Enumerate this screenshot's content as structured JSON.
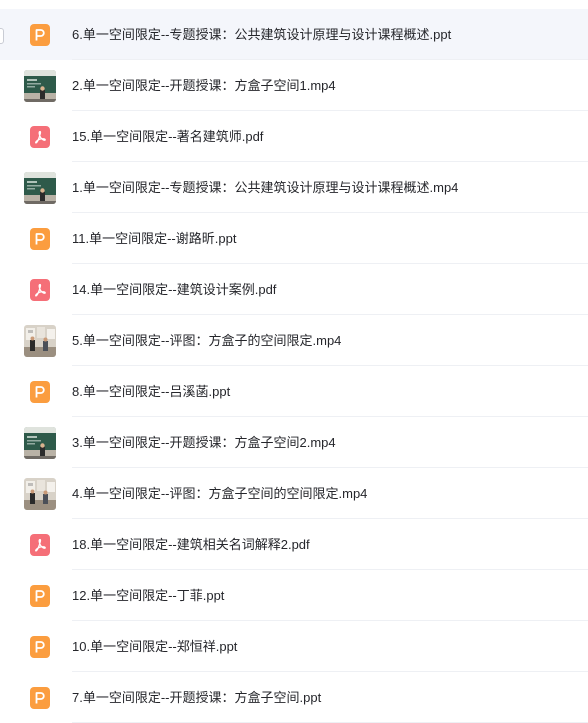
{
  "files": [
    {
      "name": "6.单一空间限定--专题授课：公共建筑设计原理与设计课程概述.ppt",
      "type": "ppt",
      "icon": "ppt-file-icon",
      "selected": true
    },
    {
      "name": "2.单一空间限定--开题授课：方盒子空间1.mp4",
      "type": "mp4",
      "thumb": "classroom",
      "icon": "video-thumbnail"
    },
    {
      "name": "15.单一空间限定--著名建筑师.pdf",
      "type": "pdf",
      "icon": "pdf-file-icon"
    },
    {
      "name": "1.单一空间限定--专题授课：公共建筑设计原理与设计课程概述.mp4",
      "type": "mp4",
      "thumb": "classroom",
      "icon": "video-thumbnail"
    },
    {
      "name": "11.单一空间限定--谢路昕.ppt",
      "type": "ppt",
      "icon": "ppt-file-icon"
    },
    {
      "name": "14.单一空间限定--建筑设计案例.pdf",
      "type": "pdf",
      "icon": "pdf-file-icon"
    },
    {
      "name": "5.单一空间限定--评图：方盒子的空间限定.mp4",
      "type": "mp4",
      "thumb": "review",
      "icon": "video-thumbnail"
    },
    {
      "name": "8.单一空间限定--吕溪菡.ppt",
      "type": "ppt",
      "icon": "ppt-file-icon"
    },
    {
      "name": "3.单一空间限定--开题授课：方盒子空间2.mp4",
      "type": "mp4",
      "thumb": "classroom",
      "icon": "video-thumbnail"
    },
    {
      "name": "4.单一空间限定--评图：方盒子空间的空间限定.mp4",
      "type": "mp4",
      "thumb": "review",
      "icon": "video-thumbnail"
    },
    {
      "name": "18.单一空间限定--建筑相关名词解释2.pdf",
      "type": "pdf",
      "icon": "pdf-file-icon"
    },
    {
      "name": "12.单一空间限定--丁菲.ppt",
      "type": "ppt",
      "icon": "ppt-file-icon"
    },
    {
      "name": "10.单一空间限定--郑恒祥.ppt",
      "type": "ppt",
      "icon": "ppt-file-icon"
    },
    {
      "name": "7.单一空间限定--开题授课：方盒子空间.ppt",
      "type": "ppt",
      "icon": "ppt-file-icon"
    }
  ],
  "colors": {
    "ppt": "#fb9d3f",
    "pdf": "#f56f78",
    "selected_row": "#f4f6fb",
    "text": "#25262b"
  }
}
